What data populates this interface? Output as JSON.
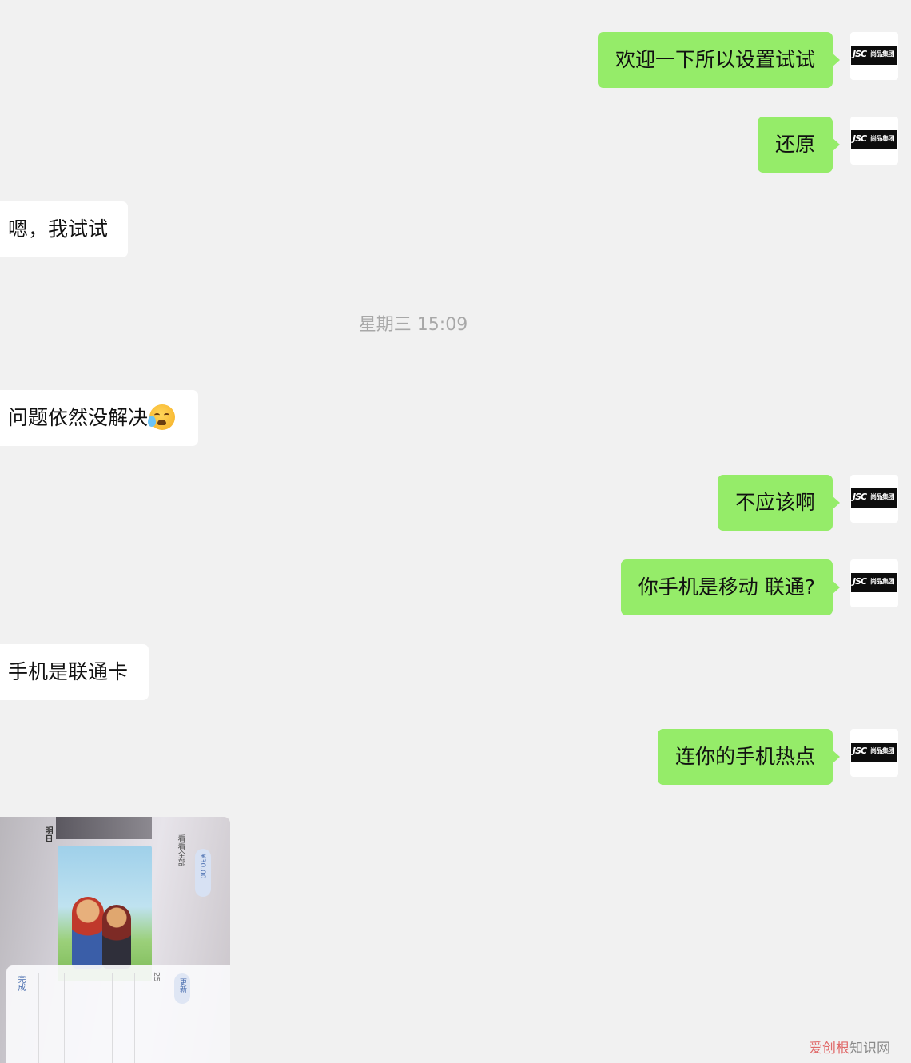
{
  "messages": [
    {
      "side": "out",
      "text": "欢迎一下所以设置试试"
    },
    {
      "side": "out",
      "text": "还原"
    },
    {
      "side": "in",
      "text": "嗯，我试试"
    },
    {
      "side": "in",
      "text": "问题依然没解决",
      "emoji": "crying-laughing-emoji"
    },
    {
      "side": "out",
      "text": "不应该啊"
    },
    {
      "side": "out",
      "text": "你手机是移动 联通?"
    },
    {
      "side": "in",
      "text": "手机是联通卡"
    },
    {
      "side": "out",
      "text": "连你的手机热点"
    },
    {
      "side": "in",
      "type": "image"
    }
  ],
  "timestamp": "星期三 15:09",
  "avatar": {
    "mark": "JSC",
    "brand": "尚品集团"
  },
  "photo": {
    "labels": [
      "完成",
      "更新",
      "看看全部",
      "¥30.00",
      "明日",
      "25"
    ]
  },
  "watermark": {
    "brand": "爱创根",
    "site": "知识网"
  },
  "colors": {
    "background": "#f1f1f1",
    "outgoing_bubble": "#95ec69",
    "incoming_bubble": "#ffffff",
    "timestamp_text": "#a8a8a8"
  }
}
